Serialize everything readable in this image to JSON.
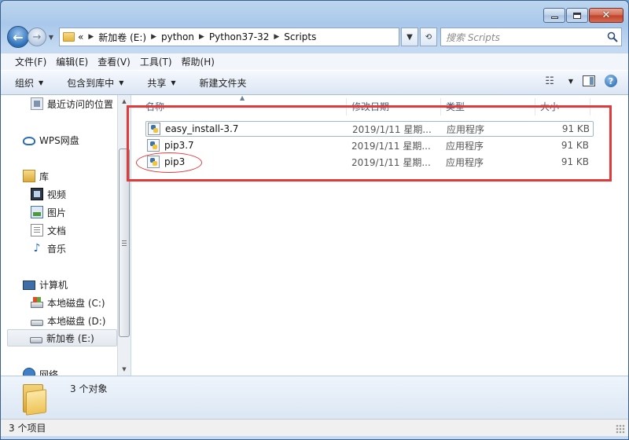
{
  "address": {
    "overflow": "«",
    "crumbs": [
      "新加卷 (E:)",
      "python",
      "Python37-32",
      "Scripts"
    ]
  },
  "search": {
    "placeholder": "搜索 Scripts"
  },
  "menu": [
    "文件(F)",
    "编辑(E)",
    "查看(V)",
    "工具(T)",
    "帮助(H)"
  ],
  "toolbar": {
    "organize": "组织",
    "include": "包含到库中",
    "share": "共享",
    "new_folder": "新建文件夹"
  },
  "nav": {
    "recent": "最近访问的位置",
    "wps": "WPS网盘",
    "library": "库",
    "video": "视频",
    "pictures": "图片",
    "documents": "文档",
    "music": "音乐",
    "computer": "计算机",
    "drive_c": "本地磁盘 (C:)",
    "drive_d": "本地磁盘 (D:)",
    "drive_e": "新加卷 (E:)",
    "network": "网络"
  },
  "columns": {
    "name": "名称",
    "date": "修改日期",
    "type": "类型",
    "size": "大小"
  },
  "files": [
    {
      "name": "easy_install-3.7",
      "date": "2019/1/11 星期...",
      "type": "应用程序",
      "size": "91 KB"
    },
    {
      "name": "pip3.7",
      "date": "2019/1/11 星期...",
      "type": "应用程序",
      "size": "91 KB"
    },
    {
      "name": "pip3",
      "date": "2019/1/11 星期...",
      "type": "应用程序",
      "size": "91 KB"
    }
  ],
  "details": {
    "count": "3 个对象"
  },
  "status": {
    "items": "3 个项目"
  },
  "caption": {
    "minimize": "—",
    "maximize": "□",
    "close": "✕"
  },
  "colors": {
    "highlight": "#e23a3a",
    "window_frame": "#bcd5ef"
  }
}
